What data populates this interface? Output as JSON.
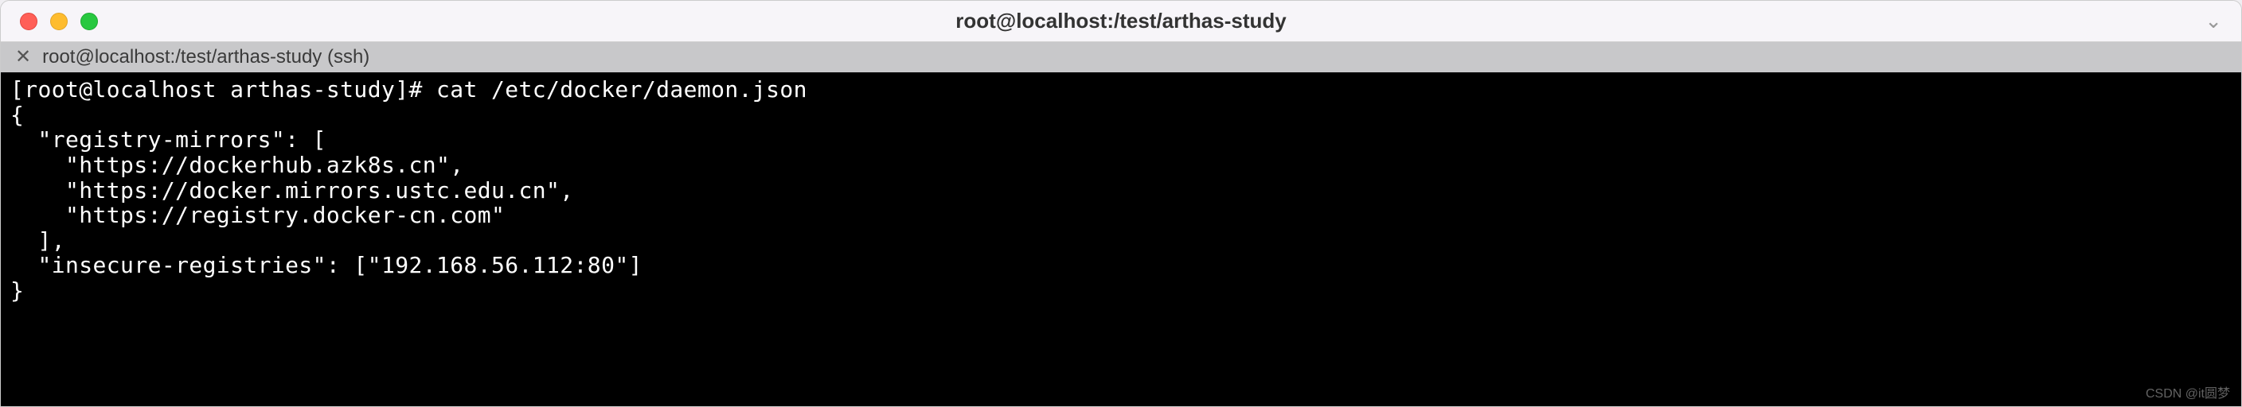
{
  "titlebar": {
    "title": "root@localhost:/test/arthas-study",
    "menu_glyph": "⌄"
  },
  "tab": {
    "close_glyph": "✕",
    "label": "root@localhost:/test/arthas-study (ssh)"
  },
  "terminal": {
    "prompt": "[root@localhost arthas-study]# ",
    "command": "cat /etc/docker/daemon.json",
    "lines": [
      "{",
      "  \"registry-mirrors\": [",
      "    \"https://dockerhub.azk8s.cn\",",
      "    \"https://docker.mirrors.ustc.edu.cn\",",
      "    \"https://registry.docker-cn.com\"",
      "  ],",
      "  \"insecure-registries\": [\"192.168.56.112:80\"]",
      "}"
    ]
  },
  "watermark": "CSDN @it圆梦"
}
